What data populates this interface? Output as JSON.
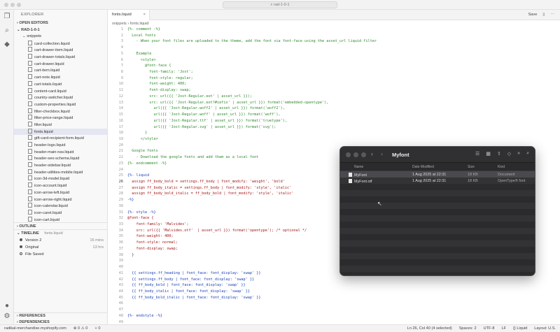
{
  "window": {
    "search_text": "⌕ rad-1-0-1"
  },
  "sidebar": {
    "header": "EXPLORER",
    "open_editors": "OPEN EDITORS",
    "root": "RAD-1-0-1",
    "folder": "snippets",
    "files": [
      "card-collection.liquid",
      "cart-drawer-item.liquid",
      "cart-drawer-totals.liquid",
      "cart-drawer.liquid",
      "cart-item.liquid",
      "cart-note.liquid",
      "cart-totals.liquid",
      "content-card.liquid",
      "country-switcher.liquid",
      "custom-properties.liquid",
      "filter-checkbox.liquid",
      "filter-price-range.liquid",
      "filter.liquid",
      "fonts.liquid",
      "gift-card-recipient-form.liquid",
      "header-logo.liquid",
      "header-main-nav.liquid",
      "header-seo-schema.liquid",
      "header-sidebar.liquid",
      "header-utilities-mobile.liquid",
      "icon-3d-model.liquid",
      "icon-account.liquid",
      "icon-arrow-left.liquid",
      "icon-arrow-right.liquid",
      "icon-calendar.liquid",
      "icon-caret.liquid",
      "icon-cart.liquid"
    ],
    "selected_index": 13,
    "outline": "OUTLINE",
    "timeline": "TIMELINE",
    "timeline_file": "fonts.liquid",
    "timeline_items": [
      {
        "label": "Version 2",
        "time": "16 mins"
      },
      {
        "label": "Original",
        "time": "13 hrs"
      },
      {
        "label": "File Saved",
        "time": ""
      }
    ],
    "references": "REFERENCES",
    "dependencies": "DEPENDENCIES"
  },
  "editor": {
    "tab_label": "fonts.liquid",
    "save_label": "Save",
    "breadcrumb": "snippets  ›  fonts.liquid",
    "active_line": 26,
    "lines": [
      {
        "n": 1,
        "t": "{%- comment -%}",
        "c": "com"
      },
      {
        "n": 2,
        "t": "  Local fonts",
        "c": "com"
      },
      {
        "n": 3,
        "t": "    - When your font files are uploaded to the theme, add the font via font-face using the asset_url liquid filter",
        "c": "com"
      },
      {
        "n": 4,
        "t": "",
        "c": "com"
      },
      {
        "n": 5,
        "t": "    Example",
        "c": "com"
      },
      {
        "n": 6,
        "t": "      <style>",
        "c": "com"
      },
      {
        "n": 7,
        "t": "        @font-face {",
        "c": "com"
      },
      {
        "n": 8,
        "t": "          font-family: 'Jost';",
        "c": "com"
      },
      {
        "n": 9,
        "t": "          font-style: regular;",
        "c": "com"
      },
      {
        "n": 10,
        "t": "          font-weight: 400;",
        "c": "com"
      },
      {
        "n": 11,
        "t": "          font-display: swap;",
        "c": "com"
      },
      {
        "n": 12,
        "t": "          src: url({{ 'Jost-Regular.eot' | asset_url }});",
        "c": "com"
      },
      {
        "n": 13,
        "t": "          src: url({{ 'Jost-Regular.eot?#iefix' | asset_url }}) format('embedded-opentype'),",
        "c": "com"
      },
      {
        "n": 14,
        "t": "            url({{ 'Jost-Regular.woff2' | asset_url }}) format('woff2'),",
        "c": "com"
      },
      {
        "n": 15,
        "t": "            url({{ 'Jost-Regular.woff' | asset_url }}) format('woff'),",
        "c": "com"
      },
      {
        "n": 16,
        "t": "            url({{ 'Jost-Regular.ttf' | asset_url }}) format('truetype'),",
        "c": "com"
      },
      {
        "n": 17,
        "t": "            url({{ 'Jost-Regular.svg' | asset_url }}) format('svg');",
        "c": "com"
      },
      {
        "n": 18,
        "t": "        }",
        "c": "com"
      },
      {
        "n": 19,
        "t": "      </style>",
        "c": "com"
      },
      {
        "n": 20,
        "t": "",
        "c": "com"
      },
      {
        "n": 21,
        "t": "  Google fonts",
        "c": "com"
      },
      {
        "n": 22,
        "t": "    - Download the google fonts and add them as a local font",
        "c": "com"
      },
      {
        "n": 23,
        "t": "{%- endcomment -%}",
        "c": "com"
      },
      {
        "n": 24,
        "t": "",
        "c": ""
      },
      {
        "n": 25,
        "t": "{%- liquid",
        "c": "tag"
      },
      {
        "n": 26,
        "t": "  assign ff_body_bold = settings.ff_body | font_modify: 'weight', 'bold'",
        "c": "kw"
      },
      {
        "n": 27,
        "t": "  assign ff_body_italic = settings.ff_body | font_modify: 'style', 'italic'",
        "c": "kw"
      },
      {
        "n": 28,
        "t": "  assign ff_body_bold_italic = ff_body_bold | font_modify: 'style', 'italic'",
        "c": "kw"
      },
      {
        "n": 29,
        "t": "-%}",
        "c": "tag"
      },
      {
        "n": 30,
        "t": "",
        "c": ""
      },
      {
        "n": 31,
        "t": "{%- style -%}",
        "c": "tag"
      },
      {
        "n": 32,
        "t": "@font-face {",
        "c": "kw"
      },
      {
        "n": 33,
        "t": "    font-family: 'Malvides';",
        "c": "kw"
      },
      {
        "n": 34,
        "t": "    src: url({{ 'Malvides.otf'  | asset_url }}) format('opentype'); /* optional */",
        "c": "kw"
      },
      {
        "n": 35,
        "t": "    font-weight: 400;",
        "c": "kw"
      },
      {
        "n": 36,
        "t": "    font-style: normal;",
        "c": "kw"
      },
      {
        "n": 37,
        "t": "    font-display: swap;",
        "c": "kw"
      },
      {
        "n": 38,
        "t": "  }",
        "c": ""
      },
      {
        "n": 39,
        "t": "",
        "c": ""
      },
      {
        "n": 40,
        "t": "",
        "c": ""
      },
      {
        "n": 41,
        "t": "  {{ settings.ff_heading | font_face: font_display: 'swap' }}",
        "c": "tag"
      },
      {
        "n": 42,
        "t": "  {{ settings.ff_body | font_face: font_display: 'swap' }}",
        "c": "tag"
      },
      {
        "n": 43,
        "t": "  {{ ff_body_bold | font_face: font_display: 'swap' }}",
        "c": "tag"
      },
      {
        "n": 44,
        "t": "  {{ ff_body_italic | font_face: font_display: 'swap' }}",
        "c": "tag"
      },
      {
        "n": 45,
        "t": "  {{ ff_body_bold_italic | font_face: font_display: 'swap' }}",
        "c": "tag"
      },
      {
        "n": 46,
        "t": "",
        "c": ""
      },
      {
        "n": 47,
        "t": "",
        "c": ""
      },
      {
        "n": 48,
        "t": "{%- endstyle -%}",
        "c": "tag"
      },
      {
        "n": 49,
        "t": "",
        "c": ""
      }
    ]
  },
  "status": {
    "remote": "radikal-merchandise.myshopify.com",
    "problems": "⊗ 0 ⚠ 0",
    "ports": "⑂ 0",
    "position": "Ln 26, Col 40 (4 selected)",
    "spaces": "Spaces: 2",
    "encoding": "UTF-8",
    "eol": "LF",
    "language": "{} Liquid",
    "layout": "Layout: U.S."
  },
  "finder": {
    "title": "Myfont",
    "columns": {
      "name": "Name",
      "date": "Date Modified",
      "size": "Size",
      "kind": "Kind"
    },
    "files": [
      {
        "name": "MyFont",
        "date": "1 Aug 2025 at 22:31",
        "size": "18 KB",
        "kind": "Document"
      },
      {
        "name": "MyFont.otf",
        "date": "1 Aug 2025 at 22:31",
        "size": "18 KB",
        "kind": "OpenType® font"
      }
    ]
  }
}
